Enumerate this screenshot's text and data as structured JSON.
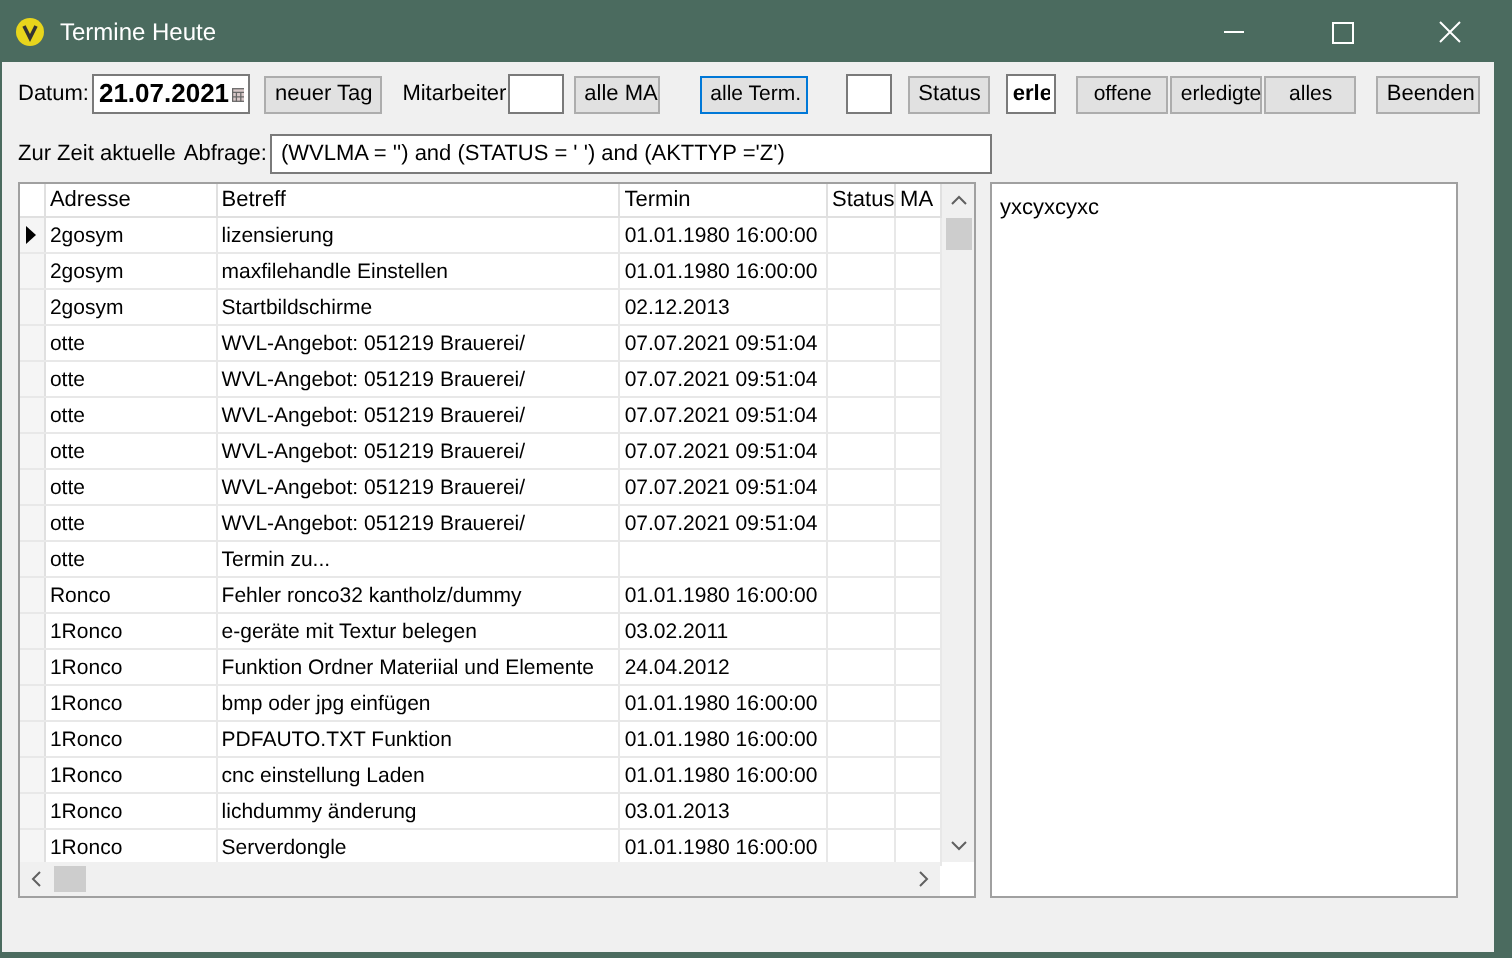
{
  "window": {
    "title": "Termine Heute"
  },
  "toolbar": {
    "date_label": "Datum:",
    "date_value": "21.07.2021",
    "new_day_button": "neuer Tag",
    "employee_label": "Mitarbeiter",
    "all_employees_button": "alle MA",
    "all_appointments_button": "alle Term.",
    "status_button": "Status",
    "status_value": "erle",
    "filter_buttons": [
      {
        "label": "offene"
      },
      {
        "label": "erledigte"
      },
      {
        "label": "alles"
      }
    ],
    "exit_button": "Beenden"
  },
  "query": {
    "label": "Zur Zeit aktuelle",
    "query_label": "Abfrage:",
    "value": "(WVLMA = '') and (STATUS = ' ') and (AKTTYP ='Z')"
  },
  "table": {
    "columns": [
      "Adresse",
      "Betreff",
      "Termin",
      "Status",
      "MA"
    ],
    "rows": [
      {
        "cells": [
          "2gosym",
          "lizensierung",
          "01.01.1980 16:00:00",
          "",
          ""
        ],
        "current": true
      },
      {
        "cells": [
          "2gosym",
          "maxfilehandle Einstellen",
          "01.01.1980 16:00:00",
          "",
          ""
        ],
        "current": false
      },
      {
        "cells": [
          "2gosym",
          "Startbildschirme",
          "02.12.2013",
          "",
          ""
        ],
        "current": false
      },
      {
        "cells": [
          "otte",
          "WVL-Angebot: 051219 Brauerei/",
          "07.07.2021 09:51:04",
          "",
          ""
        ],
        "current": false
      },
      {
        "cells": [
          "otte",
          "WVL-Angebot: 051219 Brauerei/",
          "07.07.2021 09:51:04",
          "",
          ""
        ],
        "current": false
      },
      {
        "cells": [
          "otte",
          "WVL-Angebot: 051219 Brauerei/",
          "07.07.2021 09:51:04",
          "",
          ""
        ],
        "current": false
      },
      {
        "cells": [
          "otte",
          "WVL-Angebot: 051219 Brauerei/",
          "07.07.2021 09:51:04",
          "",
          ""
        ],
        "current": false
      },
      {
        "cells": [
          "otte",
          "WVL-Angebot: 051219 Brauerei/",
          "07.07.2021 09:51:04",
          "",
          ""
        ],
        "current": false
      },
      {
        "cells": [
          "otte",
          "WVL-Angebot: 051219 Brauerei/",
          "07.07.2021 09:51:04",
          "",
          ""
        ],
        "current": false
      },
      {
        "cells": [
          "otte",
          "Termin zu...",
          "",
          "",
          ""
        ],
        "current": false
      },
      {
        "cells": [
          "Ronco",
          "Fehler ronco32 kantholz/dummy",
          "01.01.1980 16:00:00",
          "",
          ""
        ],
        "current": false
      },
      {
        "cells": [
          "1Ronco",
          "e-geräte mit Textur belegen",
          "03.02.2011",
          "",
          ""
        ],
        "current": false
      },
      {
        "cells": [
          "1Ronco",
          "Funktion Ordner Materiial und Elemente",
          "24.04.2012",
          "",
          ""
        ],
        "current": false
      },
      {
        "cells": [
          "1Ronco",
          "bmp oder jpg einfügen",
          "01.01.1980 16:00:00",
          "",
          ""
        ],
        "current": false
      },
      {
        "cells": [
          "1Ronco",
          "PDFAUTO.TXT Funktion",
          "01.01.1980 16:00:00",
          "",
          ""
        ],
        "current": false
      },
      {
        "cells": [
          "1Ronco",
          "cnc einstellung Laden",
          "01.01.1980 16:00:00",
          "",
          ""
        ],
        "current": false
      },
      {
        "cells": [
          "1Ronco",
          "lichdummy änderung",
          "03.01.2013",
          "",
          ""
        ],
        "current": false
      },
      {
        "cells": [
          "1Ronco",
          "Serverdongle",
          "01.01.1980 16:00:00",
          "",
          ""
        ],
        "current": false
      }
    ]
  },
  "memo": {
    "text": "yxcyxcyxc"
  }
}
